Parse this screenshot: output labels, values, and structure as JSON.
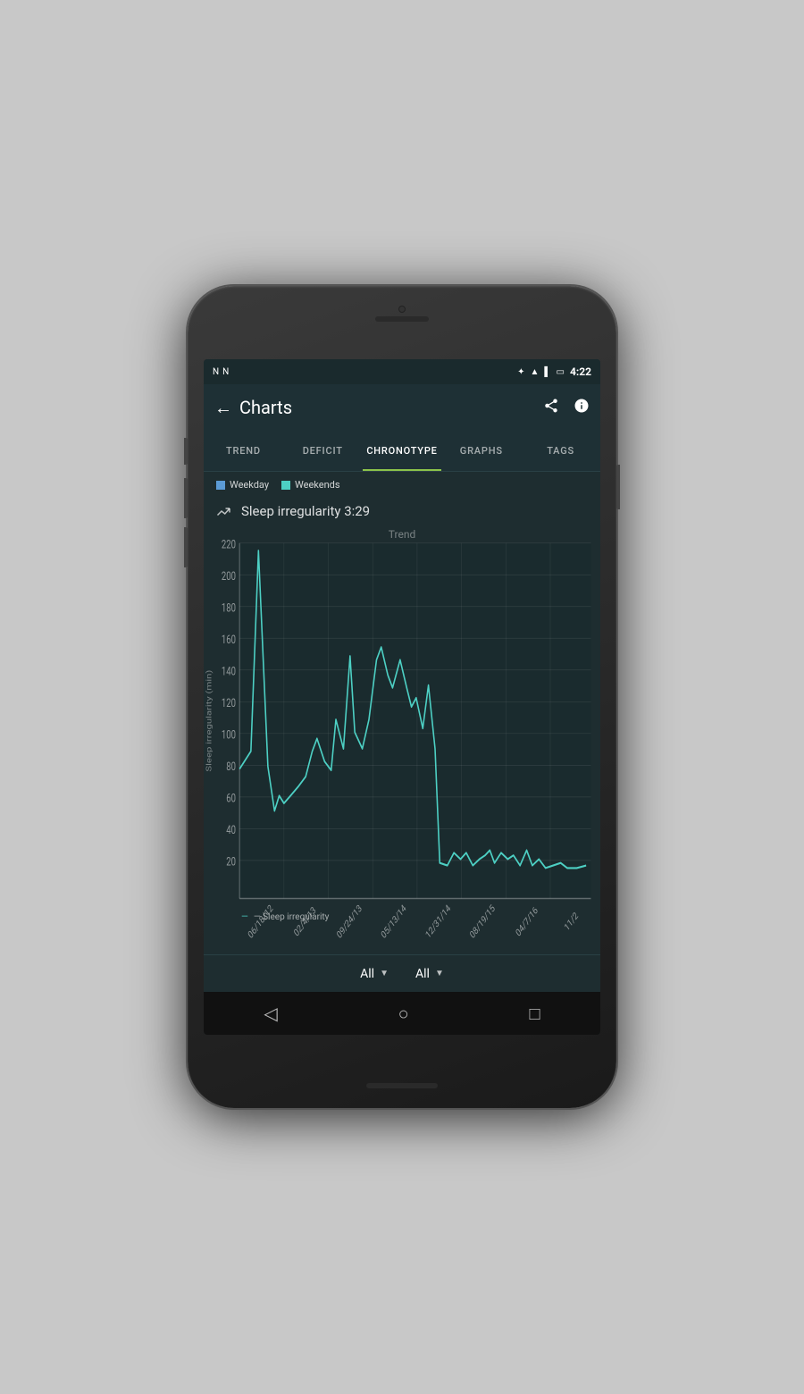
{
  "status_bar": {
    "time": "4:22",
    "icons_left": [
      "N",
      "N"
    ],
    "icons_right": [
      "bluetooth",
      "wifi",
      "signal",
      "battery"
    ]
  },
  "app_bar": {
    "title": "Charts",
    "back_label": "←",
    "share_label": "⋮",
    "info_label": "ℹ"
  },
  "tabs": [
    {
      "id": "trend",
      "label": "TREND",
      "active": false
    },
    {
      "id": "deficit",
      "label": "DEFICIT",
      "active": false
    },
    {
      "id": "chronotype",
      "label": "CHRONOTYPE",
      "active": true
    },
    {
      "id": "graphs",
      "label": "GRAPHS",
      "active": false
    },
    {
      "id": "tags",
      "label": "TAGS",
      "active": false
    }
  ],
  "legend": {
    "weekday_label": "Weekday",
    "weekend_label": "Weekends"
  },
  "sleep_header": {
    "label": "Sleep irregularity 3:29"
  },
  "chart": {
    "title": "Trend",
    "y_label": "Sleep irregularity (min)",
    "y_ticks": [
      20,
      40,
      60,
      80,
      100,
      120,
      140,
      160,
      180,
      200,
      220
    ],
    "x_ticks": [
      "06/18/12",
      "02/4/13",
      "09/24/13",
      "05/13/14",
      "12/31/14",
      "08/19/15",
      "04/7/16",
      "11/2"
    ],
    "legend_line": "— Sleep irregularity",
    "line_color": "#4dd0c4"
  },
  "bottom_controls": {
    "filter1_label": "All",
    "filter2_label": "All"
  },
  "nav_bar": {
    "back": "◁",
    "home": "○",
    "recent": "□"
  }
}
